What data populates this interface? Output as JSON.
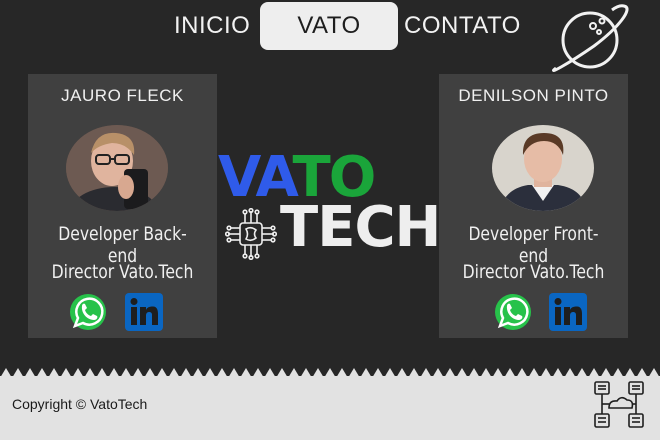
{
  "nav": {
    "items": [
      {
        "label": "INICIO",
        "active": false
      },
      {
        "label": "VATO",
        "active": true
      },
      {
        "label": "CONTATO",
        "active": false
      }
    ]
  },
  "cards": [
    {
      "name": "JAURO FLECK",
      "role": "Developer Back-end",
      "title": "Director Vato.Tech"
    },
    {
      "name": "DENILSON PINTO",
      "role": "Developer Front-end",
      "title": "Director Vato.Tech"
    }
  ],
  "logo": {
    "word1_part1": "VA",
    "word1_part2": "TO",
    "word2": "TECH"
  },
  "footer": {
    "copyright": "Copyright © VatoTech"
  },
  "colors": {
    "blue": "#2f5bea",
    "green": "#1aa53a",
    "whatsapp": "#27c24a",
    "linkedin": "#0a66c2"
  },
  "icons": [
    "planet-icon",
    "whatsapp-icon",
    "linkedin-icon",
    "chip-icon",
    "network-icon"
  ]
}
